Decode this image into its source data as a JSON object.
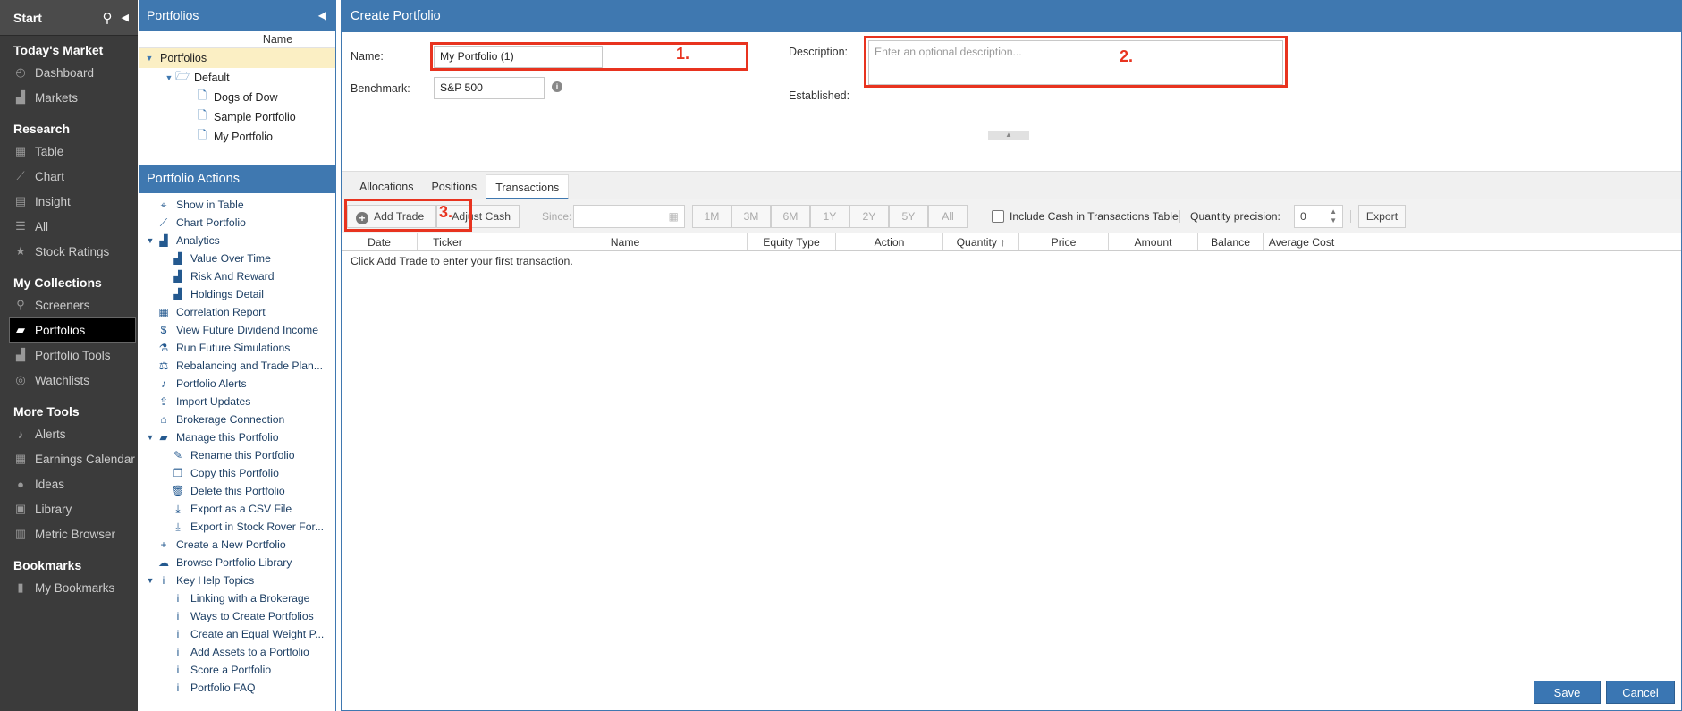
{
  "sidebar": {
    "start": "Start",
    "sections": [
      {
        "title": "Today's Market",
        "items": [
          {
            "label": "Dashboard",
            "icon": "dashboard-icon",
            "glyph": "◴"
          },
          {
            "label": "Markets",
            "icon": "markets-icon",
            "glyph": "▟"
          }
        ]
      },
      {
        "title": "Research",
        "items": [
          {
            "label": "Table",
            "icon": "table-icon",
            "glyph": "▦"
          },
          {
            "label": "Chart",
            "icon": "chart-icon",
            "glyph": "⟋"
          },
          {
            "label": "Insight",
            "icon": "insight-icon",
            "glyph": "▤"
          },
          {
            "label": "All",
            "icon": "list-icon",
            "glyph": "☰"
          },
          {
            "label": "Stock Ratings",
            "icon": "star-icon",
            "glyph": "★"
          }
        ]
      },
      {
        "title": "My Collections",
        "items": [
          {
            "label": "Screeners",
            "icon": "search-icon",
            "glyph": "⚲"
          },
          {
            "label": "Portfolios",
            "icon": "briefcase-icon",
            "glyph": "▰",
            "active": true
          },
          {
            "label": "Portfolio Tools",
            "icon": "tools-icon",
            "glyph": "▟"
          },
          {
            "label": "Watchlists",
            "icon": "binoculars-icon",
            "glyph": "◎"
          }
        ]
      },
      {
        "title": "More Tools",
        "items": [
          {
            "label": "Alerts",
            "icon": "bell-icon",
            "glyph": "♪"
          },
          {
            "label": "Earnings Calendar",
            "icon": "calendar-icon",
            "glyph": "▦"
          },
          {
            "label": "Ideas",
            "icon": "lightbulb-icon",
            "glyph": "●"
          },
          {
            "label": "Library",
            "icon": "library-icon",
            "glyph": "▣"
          },
          {
            "label": "Metric Browser",
            "icon": "metric-icon",
            "glyph": "▥"
          }
        ]
      },
      {
        "title": "Bookmarks",
        "items": [
          {
            "label": "My Bookmarks",
            "icon": "bookmark-icon",
            "glyph": "▮"
          }
        ]
      }
    ]
  },
  "tree": {
    "title": "Portfolios",
    "column": "Name",
    "nodes": [
      {
        "label": "Portfolios",
        "depth": 0,
        "toggle": "▼",
        "selected": true,
        "icon": ""
      },
      {
        "label": "Default",
        "depth": 1,
        "toggle": "▼",
        "icon": "folder-open-icon",
        "glyph": "🗁"
      },
      {
        "label": "Dogs of Dow",
        "depth": 2,
        "icon": "document-icon",
        "glyph": "🗋"
      },
      {
        "label": "Sample Portfolio",
        "depth": 2,
        "icon": "document-icon",
        "glyph": "🗋"
      },
      {
        "label": "My Portfolio",
        "depth": 2,
        "icon": "document-icon",
        "glyph": "🗋"
      }
    ]
  },
  "actions": {
    "title": "Portfolio Actions",
    "items": [
      {
        "label": "Show in Table",
        "depth": 0,
        "icon": "binoculars-icon",
        "glyph": "⌖"
      },
      {
        "label": "Chart Portfolio",
        "depth": 0,
        "icon": "chart-icon",
        "glyph": "⟋"
      },
      {
        "label": "Analytics",
        "depth": 0,
        "toggle": "▼",
        "icon": "analytics-icon",
        "glyph": "▟"
      },
      {
        "label": "Value Over Time",
        "depth": 1,
        "icon": "bar-chart-icon",
        "glyph": "▟"
      },
      {
        "label": "Risk And Reward",
        "depth": 1,
        "icon": "bar-chart-icon",
        "glyph": "▟"
      },
      {
        "label": "Holdings Detail",
        "depth": 1,
        "icon": "bar-chart-icon",
        "glyph": "▟"
      },
      {
        "label": "Correlation Report",
        "depth": 0,
        "icon": "grid-icon",
        "glyph": "▦"
      },
      {
        "label": "View Future Dividend Income",
        "depth": 0,
        "icon": "dollar-icon",
        "glyph": "$"
      },
      {
        "label": "Run Future Simulations",
        "depth": 0,
        "icon": "flask-icon",
        "glyph": "⚗"
      },
      {
        "label": "Rebalancing and Trade Plan...",
        "depth": 0,
        "icon": "scale-icon",
        "glyph": "⚖"
      },
      {
        "label": "Portfolio Alerts",
        "depth": 0,
        "icon": "bell-icon",
        "glyph": "♪"
      },
      {
        "label": "Import Updates",
        "depth": 0,
        "icon": "upload-icon",
        "glyph": "⇪"
      },
      {
        "label": "Brokerage Connection",
        "depth": 0,
        "icon": "bank-icon",
        "glyph": "⌂"
      },
      {
        "label": "Manage this Portfolio",
        "depth": 0,
        "toggle": "▼",
        "icon": "folder-icon",
        "glyph": "▰"
      },
      {
        "label": "Rename this Portfolio",
        "depth": 1,
        "icon": "edit-icon",
        "glyph": "✎"
      },
      {
        "label": "Copy this Portfolio",
        "depth": 1,
        "icon": "copy-icon",
        "glyph": "❐"
      },
      {
        "label": "Delete this Portfolio",
        "depth": 1,
        "icon": "trash-icon",
        "glyph": "🗑"
      },
      {
        "label": "Export as a CSV File",
        "depth": 1,
        "icon": "download-icon",
        "glyph": "⤓"
      },
      {
        "label": "Export in Stock Rover For...",
        "depth": 1,
        "icon": "download-icon",
        "glyph": "⤓"
      },
      {
        "label": "Create a New Portfolio",
        "depth": 0,
        "icon": "plus-icon",
        "glyph": "+"
      },
      {
        "label": "Browse Portfolio Library",
        "depth": 0,
        "icon": "cloud-download-icon",
        "glyph": "☁"
      },
      {
        "label": "Key Help Topics",
        "depth": 0,
        "toggle": "▼",
        "icon": "info-icon",
        "glyph": "i"
      },
      {
        "label": "Linking with a Brokerage",
        "depth": 1,
        "icon": "info-icon",
        "glyph": "i"
      },
      {
        "label": "Ways to Create Portfolios",
        "depth": 1,
        "icon": "info-icon",
        "glyph": "i"
      },
      {
        "label": "Create an Equal Weight P...",
        "depth": 1,
        "icon": "info-icon",
        "glyph": "i"
      },
      {
        "label": "Add Assets to a Portfolio",
        "depth": 1,
        "icon": "info-icon",
        "glyph": "i"
      },
      {
        "label": "Score a Portfolio",
        "depth": 1,
        "icon": "info-icon",
        "glyph": "i"
      },
      {
        "label": "Portfolio FAQ",
        "depth": 1,
        "icon": "info-icon",
        "glyph": "i"
      }
    ]
  },
  "main": {
    "title": "Create Portfolio",
    "form": {
      "name_label": "Name:",
      "name_value": "My Portfolio (1)",
      "benchmark_label": "Benchmark:",
      "benchmark_value": "S&P 500",
      "description_label": "Description:",
      "description_placeholder": "Enter an optional description...",
      "established_label": "Established:"
    },
    "annotations": {
      "one": "1.",
      "two": "2.",
      "three": "3."
    },
    "tabs": [
      {
        "label": "Allocations"
      },
      {
        "label": "Positions"
      },
      {
        "label": "Transactions",
        "active": true
      }
    ],
    "toolbar": {
      "add_trade": "Add Trade",
      "adjust_cash": "Adjust Cash",
      "since": "Since:",
      "periods": [
        "1M",
        "3M",
        "6M",
        "1Y",
        "2Y",
        "5Y",
        "All"
      ],
      "include_cash": "Include Cash in Transactions Table",
      "qty_precision_label": "Quantity precision:",
      "qty_precision_value": "0",
      "export": "Export"
    },
    "grid": {
      "columns": [
        "Date",
        "Ticker",
        "",
        "Name",
        "Equity Type",
        "Action",
        "Quantity",
        "Price",
        "Amount",
        "Balance",
        "Average Cost"
      ],
      "empty": "Click Add Trade to enter your first transaction."
    },
    "footer": {
      "save": "Save",
      "cancel": "Cancel"
    }
  },
  "colors": {
    "accent": "#3f78b0",
    "annotation": "#e8331f",
    "selected": "#fbefc4"
  }
}
